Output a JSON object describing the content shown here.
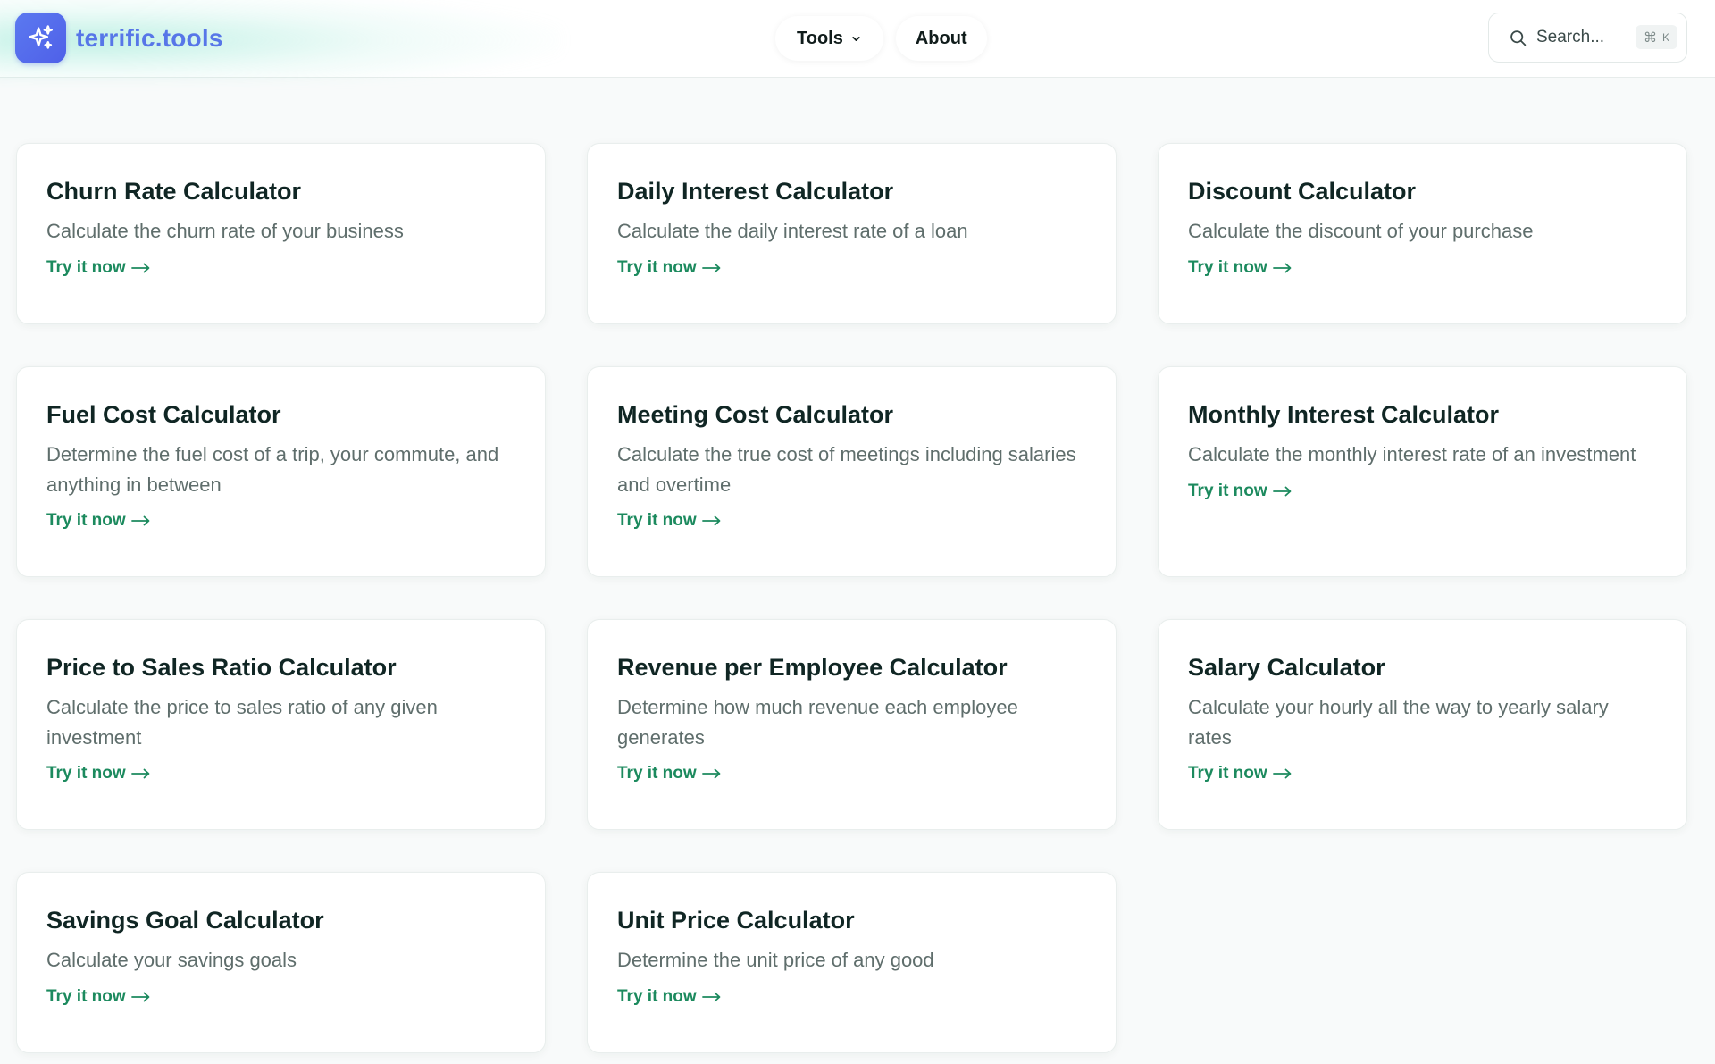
{
  "brand": {
    "name": "terrific.tools",
    "logo_icon": "sparkles-icon",
    "color": "#5776e8"
  },
  "nav": {
    "tools_label": "Tools",
    "about_label": "About"
  },
  "search": {
    "placeholder": "Search...",
    "shortcut_symbol": "⌘",
    "shortcut_key": "K"
  },
  "accent_color": "#1c8a5e",
  "tools": [
    {
      "title": "Churn Rate Calculator",
      "description": "Calculate the churn rate of your business",
      "cta": "Try it now"
    },
    {
      "title": "Daily Interest Calculator",
      "description": "Calculate the daily interest rate of a loan",
      "cta": "Try it now"
    },
    {
      "title": "Discount Calculator",
      "description": "Calculate the discount of your purchase",
      "cta": "Try it now"
    },
    {
      "title": "Fuel Cost Calculator",
      "description": "Determine the fuel cost of a trip, your commute, and anything in between",
      "cta": "Try it now"
    },
    {
      "title": "Meeting Cost Calculator",
      "description": "Calculate the true cost of meetings including salaries and overtime",
      "cta": "Try it now"
    },
    {
      "title": "Monthly Interest Calculator",
      "description": "Calculate the monthly interest rate of an investment",
      "cta": "Try it now"
    },
    {
      "title": "Price to Sales Ratio Calculator",
      "description": "Calculate the price to sales ratio of any given investment",
      "cta": "Try it now"
    },
    {
      "title": "Revenue per Employee Calculator",
      "description": "Determine how much revenue each employee generates",
      "cta": "Try it now"
    },
    {
      "title": "Salary Calculator",
      "description": "Calculate your hourly all the way to yearly salary rates",
      "cta": "Try it now"
    },
    {
      "title": "Savings Goal Calculator",
      "description": "Calculate your savings goals",
      "cta": "Try it now"
    },
    {
      "title": "Unit Price Calculator",
      "description": "Determine the unit price of any good",
      "cta": "Try it now"
    }
  ]
}
